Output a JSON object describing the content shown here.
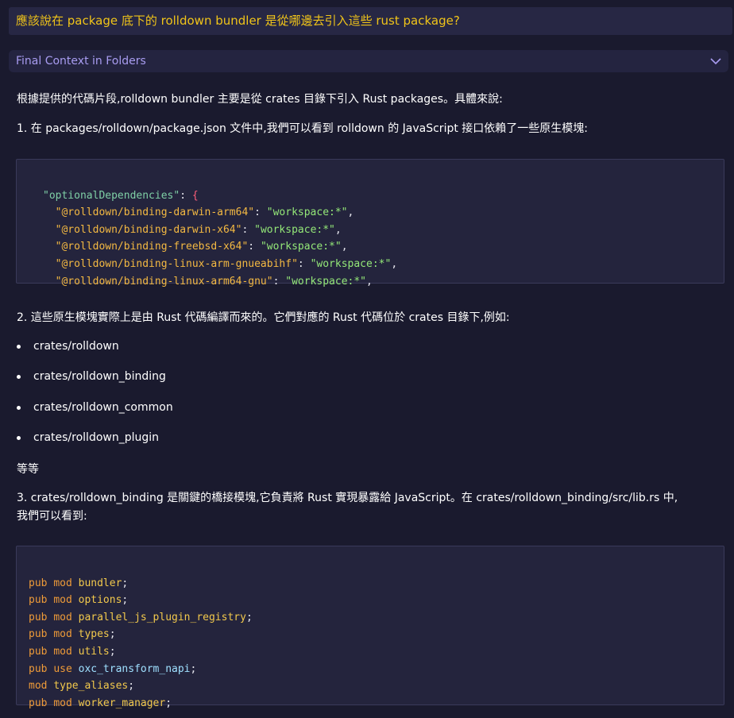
{
  "question": "應該說在 package 底下的 rolldown bundler 是從哪邊去引入這些 rust package?",
  "context_label": "Final Context in Folders",
  "answer": {
    "intro": "根據提供的代碼片段,rolldown bundler 主要是從 crates 目錄下引入 Rust packages。具體來說:",
    "point1": "1. 在 packages/rolldown/package.json 文件中,我們可以看到 rolldown 的 JavaScript 接口依賴了一些原生模塊:",
    "code1": {
      "head_key": "\"optionalDependencies\"",
      "head_colon": ": ",
      "head_brace": "{",
      "lines": [
        {
          "key": "\"@rolldown/binding-darwin-arm64\"",
          "value": "\"workspace:*\""
        },
        {
          "key": "\"@rolldown/binding-darwin-x64\"",
          "value": "\"workspace:*\""
        },
        {
          "key": "\"@rolldown/binding-freebsd-x64\"",
          "value": "\"workspace:*\""
        },
        {
          "key": "\"@rolldown/binding-linux-arm-gnueabihf\"",
          "value": "\"workspace:*\""
        },
        {
          "key": "\"@rolldown/binding-linux-arm64-gnu\"",
          "value": "\"workspace:*\""
        }
      ]
    },
    "point2": "2. 這些原生模塊實際上是由 Rust 代碼編譯而來的。它們對應的 Rust 代碼位於 crates 目錄下,例如:",
    "bullets": [
      "crates/rolldown",
      "crates/rolldown_binding",
      "crates/rolldown_common",
      "crates/rolldown_plugin"
    ],
    "etc": "等等",
    "point3_line1": "3. crates/rolldown_binding 是關鍵的橋接模塊,它負責將 Rust 實現暴露給 JavaScript。在 crates/rolldown_binding/src/lib.rs 中,",
    "point3_line2": "我們可以看到:",
    "code2": [
      {
        "kw1": "pub",
        "kw2": "mod",
        "name": "bundler"
      },
      {
        "kw1": "pub",
        "kw2": "mod",
        "name": "options"
      },
      {
        "kw1": "pub",
        "kw2": "mod",
        "name": "parallel_js_plugin_registry"
      },
      {
        "kw1": "pub",
        "kw2": "mod",
        "name": "types"
      },
      {
        "kw1": "pub",
        "kw2": "mod",
        "name": "utils"
      },
      {
        "kw1": "pub",
        "kw2": "use",
        "name": "oxc_transform_napi"
      },
      {
        "kw1": "",
        "kw2": "mod",
        "name": "type_aliases"
      },
      {
        "kw1": "pub",
        "kw2": "mod",
        "name": "worker_manager"
      }
    ]
  },
  "colors": {
    "background": "#1a1a2e",
    "question_text": "#f0c419",
    "context_label": "#a89cf0",
    "code_bg": "#24243d"
  }
}
